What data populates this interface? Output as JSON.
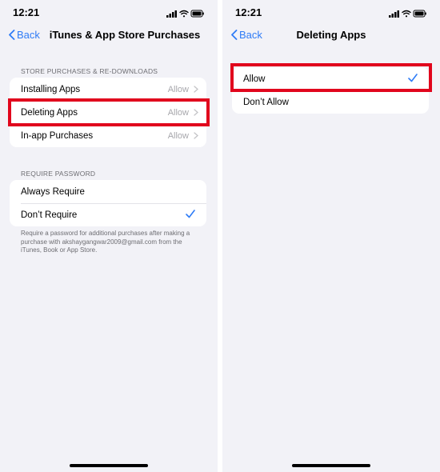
{
  "left": {
    "status": {
      "time": "12:21"
    },
    "nav": {
      "back": "Back",
      "title": "iTunes & App Store Purchases"
    },
    "section1": {
      "header": "STORE PURCHASES & RE-DOWNLOADS",
      "rows": [
        {
          "label": "Installing Apps",
          "value": "Allow"
        },
        {
          "label": "Deleting Apps",
          "value": "Allow"
        },
        {
          "label": "In-app Purchases",
          "value": "Allow"
        }
      ]
    },
    "section2": {
      "header": "REQUIRE PASSWORD",
      "rows": [
        {
          "label": "Always Require"
        },
        {
          "label": "Don’t Require",
          "selected": true
        }
      ],
      "footer": "Require a password for additional purchases after making a purchase with akshaygangwar2009@gmail.com from the iTunes, Book or App Store."
    }
  },
  "right": {
    "status": {
      "time": "12:21"
    },
    "nav": {
      "back": "Back",
      "title": "Deleting Apps"
    },
    "options": [
      {
        "label": "Allow",
        "selected": true
      },
      {
        "label": "Don’t Allow"
      }
    ]
  },
  "colors": {
    "accent": "#2f7cf6",
    "highlight": "#e1061d",
    "background": "#f2f2f7"
  }
}
